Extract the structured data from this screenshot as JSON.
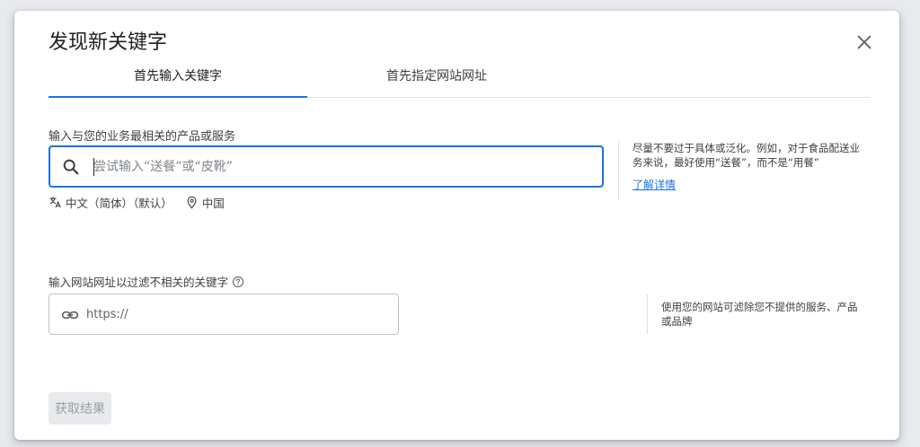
{
  "dialog": {
    "title": "发现新关键字",
    "close_icon": "close-icon"
  },
  "tabs": [
    {
      "label": "首先输入关键字",
      "active": true
    },
    {
      "label": "首先指定网站网址",
      "active": false
    }
  ],
  "keywords_section": {
    "label": "输入与您的业务最相关的产品或服务",
    "input_placeholder": "尝试输入“送餐”或“皮靴”",
    "input_value": "",
    "language": "中文（简体）（默认）",
    "location": "中国",
    "hint": "尽量不要过于具体或泛化。例如，对于食品配送业务来说，最好使用“送餐”，而不是“用餐”",
    "learn_more": "了解详情"
  },
  "website_section": {
    "label": "输入网站网址以过滤不相关的关键字",
    "input_placeholder": "https://",
    "input_value": "",
    "hint": "使用您的网站可滤除您不提供的服务、产品或品牌"
  },
  "submit_button": {
    "label": "获取结果",
    "disabled": true
  },
  "colors": {
    "accent": "#1a73e8",
    "disabled_bg": "#e8eaed",
    "disabled_text": "#9aa0a6"
  }
}
